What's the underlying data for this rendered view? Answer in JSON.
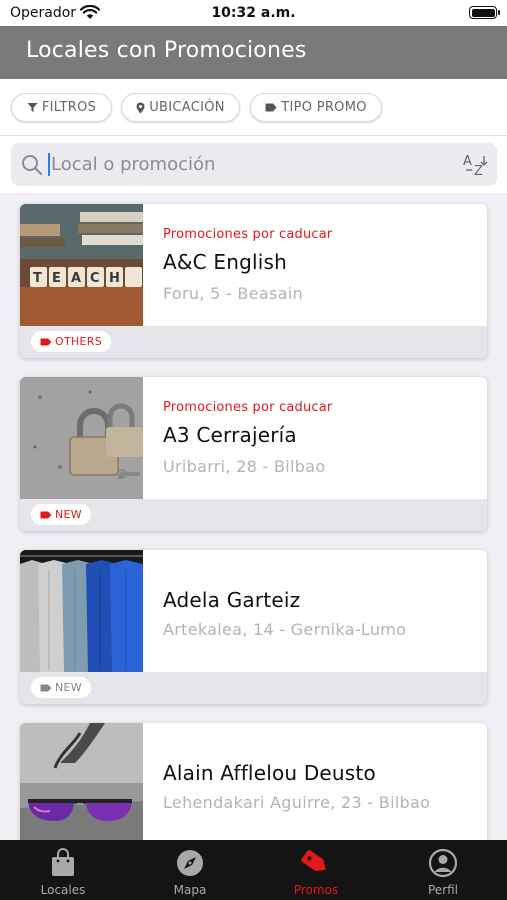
{
  "status_bar": {
    "carrier": "Operador",
    "time": "10:32 a.m."
  },
  "header": {
    "title": "Locales con Promociones"
  },
  "filters": [
    {
      "label": "FILTROS",
      "icon": "filter-icon"
    },
    {
      "label": "UBICACIÓN",
      "icon": "location-pin-icon"
    },
    {
      "label": "TIPO PROMO",
      "icon": "tag-icon"
    }
  ],
  "search": {
    "placeholder": "Local o promoción",
    "sort_icon": "sort-alpha-icon"
  },
  "colors": {
    "accent": "#e0191a",
    "header_bg": "#7a7a7a",
    "tab_bar_bg": "#141414"
  },
  "stores": [
    {
      "promo": "Promociones por caducar",
      "name": "A&C English",
      "address": "Foru, 5 - Beasain",
      "tag": "OTHERS",
      "tag_color": "red",
      "image": "teach-blocks-photo"
    },
    {
      "promo": "Promociones por caducar",
      "name": "A3 Cerrajería",
      "address": "Uribarri, 28 - Bilbao",
      "tag": "NEW",
      "tag_color": "red",
      "image": "padlock-photo"
    },
    {
      "promo": "",
      "name": "Adela Garteiz",
      "address": "Artekalea, 14 - Gernika-Lumo",
      "tag": "NEW",
      "tag_color": "grey",
      "image": "clothing-rack-photo"
    },
    {
      "promo": "",
      "name": "Alain Afflelou Deusto",
      "address": "Lehendakari Aguirre, 23 - Bilbao",
      "tag": "",
      "tag_color": "grey",
      "image": "sunglasses-photo"
    }
  ],
  "tabs": [
    {
      "label": "Locales",
      "icon": "shopping-bag-icon",
      "active": false
    },
    {
      "label": "Mapa",
      "icon": "compass-icon",
      "active": false
    },
    {
      "label": "Promos",
      "icon": "tag-icon",
      "active": true
    },
    {
      "label": "Perfil",
      "icon": "profile-icon",
      "active": false
    }
  ]
}
